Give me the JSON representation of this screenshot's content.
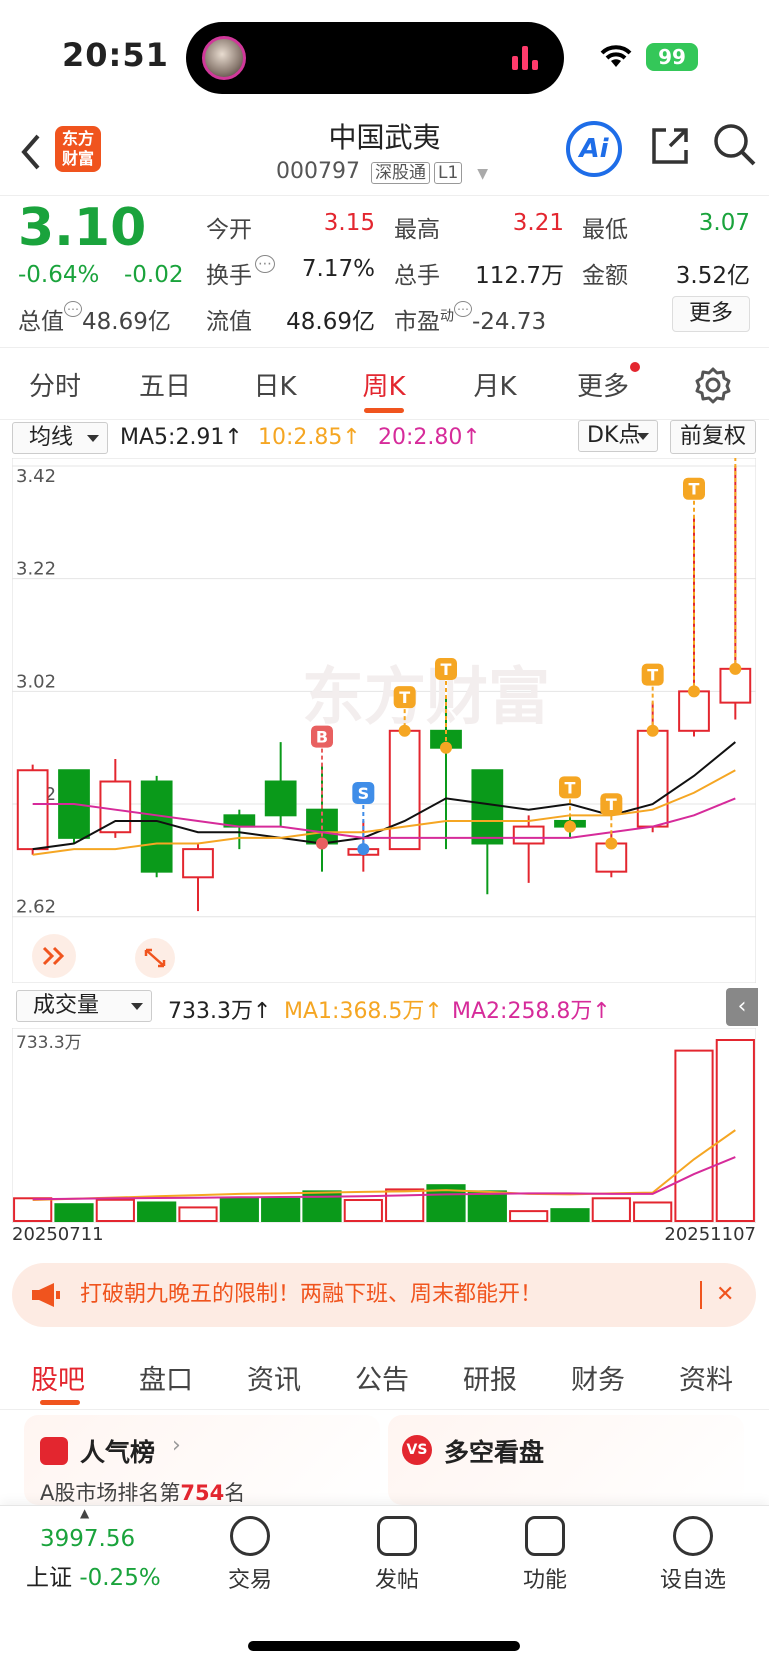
{
  "status_bar": {
    "time": "20:51",
    "battery": "99"
  },
  "header": {
    "logo_text": "东方财富",
    "stock_name": "中国武夷",
    "stock_code": "000797",
    "tag1": "深股通",
    "tag2": "L1",
    "ai_label": "Ai"
  },
  "quote": {
    "price": "3.10",
    "change_pct": "-0.64%",
    "change": "-0.02",
    "open_label": "今开",
    "open": "3.15",
    "high_label": "最高",
    "high": "3.21",
    "low_label": "最低",
    "low": "3.07",
    "turnover_label": "换手",
    "turnover": "7.17%",
    "volume_label": "总手",
    "volume": "112.7万",
    "amount_label": "金额",
    "amount": "3.52亿",
    "mcap_label": "总值",
    "mcap": "48.69亿",
    "float_label": "流值",
    "float_cap": "48.69亿",
    "pe_label": "市盈",
    "pe_sup": "动",
    "pe": "-24.73",
    "more": "更多"
  },
  "period_tabs": [
    "分时",
    "五日",
    "日K",
    "周K",
    "月K",
    "更多"
  ],
  "ma_bar": {
    "selector": "均线",
    "ma5": "MA5:2.91↑",
    "ma10": "10:2.85↑",
    "ma20": "20:2.80↑",
    "dk": "DK点",
    "adjust": "前复权"
  },
  "volume_bar": {
    "selector": "成交量",
    "vol": "733.3万↑",
    "ma1": "MA1:368.5万↑",
    "ma2": "MA2:258.8万↑"
  },
  "chart_data": {
    "type": "candlestick",
    "yticks": [
      "3.42",
      "3.22",
      "3.02",
      "2.82",
      "2.62"
    ],
    "ylim": [
      2.6,
      3.42
    ],
    "candles": [
      {
        "o": 2.74,
        "c": 2.88,
        "h": 2.89,
        "l": 2.73
      },
      {
        "o": 2.88,
        "c": 2.76,
        "h": 2.88,
        "l": 2.75
      },
      {
        "o": 2.77,
        "c": 2.86,
        "h": 2.9,
        "l": 2.76
      },
      {
        "o": 2.86,
        "c": 2.7,
        "h": 2.87,
        "l": 2.69
      },
      {
        "o": 2.69,
        "c": 2.74,
        "h": 2.75,
        "l": 2.63
      },
      {
        "o": 2.8,
        "c": 2.78,
        "h": 2.81,
        "l": 2.74
      },
      {
        "o": 2.86,
        "c": 2.8,
        "h": 2.93,
        "l": 2.78
      },
      {
        "o": 2.81,
        "c": 2.75,
        "h": 2.89,
        "l": 2.7
      },
      {
        "o": 2.73,
        "c": 2.74,
        "h": 2.79,
        "l": 2.7
      },
      {
        "o": 2.74,
        "c": 2.95,
        "h": 2.96,
        "l": 2.74
      },
      {
        "o": 2.95,
        "c": 2.92,
        "h": 3.01,
        "l": 2.74
      },
      {
        "o": 2.88,
        "c": 2.75,
        "h": 2.88,
        "l": 2.66
      },
      {
        "o": 2.75,
        "c": 2.78,
        "h": 2.8,
        "l": 2.68
      },
      {
        "o": 2.79,
        "c": 2.78,
        "h": 2.8,
        "l": 2.76
      },
      {
        "o": 2.7,
        "c": 2.75,
        "h": 2.77,
        "l": 2.69
      },
      {
        "o": 2.78,
        "c": 2.95,
        "h": 3.0,
        "l": 2.77
      },
      {
        "o": 2.95,
        "c": 3.02,
        "h": 3.33,
        "l": 2.94
      },
      {
        "o": 3.0,
        "c": 3.06,
        "h": 3.42,
        "l": 2.97
      }
    ],
    "ma5": [
      2.74,
      2.75,
      2.79,
      2.79,
      2.77,
      2.77,
      2.76,
      2.75,
      2.76,
      2.79,
      2.83,
      2.82,
      2.81,
      2.82,
      2.8,
      2.82,
      2.87,
      2.93
    ],
    "ma10": [
      2.73,
      2.74,
      2.74,
      2.75,
      2.75,
      2.76,
      2.76,
      2.77,
      2.77,
      2.78,
      2.79,
      2.79,
      2.79,
      2.8,
      2.8,
      2.81,
      2.84,
      2.88
    ],
    "ma20": [
      2.82,
      2.82,
      2.81,
      2.8,
      2.79,
      2.78,
      2.78,
      2.77,
      2.76,
      2.76,
      2.76,
      2.76,
      2.76,
      2.76,
      2.77,
      2.78,
      2.8,
      2.83
    ],
    "markers": [
      {
        "i": 7,
        "t": "B"
      },
      {
        "i": 8,
        "t": "S"
      },
      {
        "i": 9,
        "t": "T"
      },
      {
        "i": 10,
        "t": "T"
      },
      {
        "i": 13,
        "t": "T"
      },
      {
        "i": 14,
        "t": "T"
      },
      {
        "i": 15,
        "t": "T"
      },
      {
        "i": 16,
        "t": "T"
      },
      {
        "i": 17,
        "t": "T"
      }
    ],
    "volume_top_label": "733.3万",
    "volumes": [
      92,
      68,
      86,
      75,
      55,
      92,
      90,
      120,
      85,
      128,
      145,
      120,
      40,
      48,
      92,
      75,
      690,
      733
    ],
    "vol_ma1": [
      85,
      90,
      95,
      100,
      105,
      110,
      112,
      115,
      118,
      120,
      125,
      118,
      110,
      108,
      112,
      115,
      250,
      368
    ],
    "vol_ma2": [
      88,
      90,
      92,
      93,
      94,
      96,
      97,
      98,
      100,
      104,
      108,
      110,
      112,
      112,
      110,
      110,
      190,
      259
    ],
    "date_start": "20250711",
    "date_end": "20251107"
  },
  "ad": {
    "text": "打破朝九晚五的限制！两融下班、周末都能开！",
    "close": "✕"
  },
  "bottom_tabs": [
    "股吧",
    "盘口",
    "资讯",
    "公告",
    "研报",
    "财务",
    "资料"
  ],
  "cards": {
    "left_title": "人气榜",
    "left_sub": "A股市场排名第",
    "left_rank": "754",
    "left_suffix": "名",
    "right_title": "多空看盘"
  },
  "bottom_nav": {
    "index_value": "3997.56",
    "index_name": "上证",
    "index_pct": "-0.25%",
    "items": [
      "交易",
      "发帖",
      "功能",
      "设自选"
    ]
  }
}
